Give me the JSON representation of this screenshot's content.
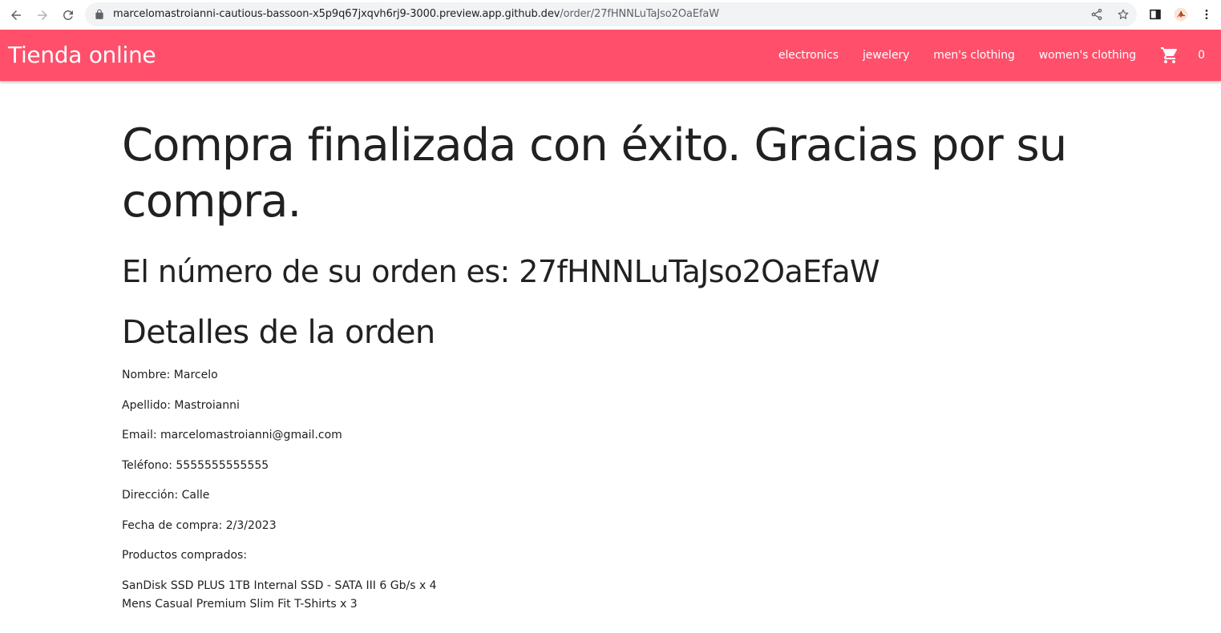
{
  "browser": {
    "url_host": "marcelomastroianni-cautious-bassoon-x5p9q67jxqvh6rj9-3000.preview.app.github.dev",
    "url_path": "/order/27fHNNLuTaJso2OaEfaW"
  },
  "header": {
    "brand": "Tienda online",
    "nav": [
      {
        "label": "electronics"
      },
      {
        "label": "jewelery"
      },
      {
        "label": "men's clothing"
      },
      {
        "label": "women's clothing"
      }
    ],
    "cart_count": "0"
  },
  "main": {
    "title": "Compra finalizada con éxito. Gracias por su compra.",
    "order_number": "El número de su orden es: 27fHNNLuTaJso2OaEfaW",
    "details_title": "Detalles de la orden",
    "details": {
      "nombre": "Nombre: Marcelo",
      "apellido": "Apellido: Mastroianni",
      "email": "Email: marcelomastroianni@gmail.com",
      "telefono": "Teléfono: 5555555555555",
      "direccion": "Dirección: Calle",
      "fecha": "Fecha de compra: 2/3/2023",
      "productos_label": "Productos comprados:"
    },
    "products": [
      "SanDisk SSD PLUS 1TB Internal SSD - SATA III 6 Gb/s x 4",
      "Mens Casual Premium Slim Fit T-Shirts x 3"
    ]
  },
  "colors": {
    "header_bg": "#ff4f6b",
    "text": "#212121"
  }
}
